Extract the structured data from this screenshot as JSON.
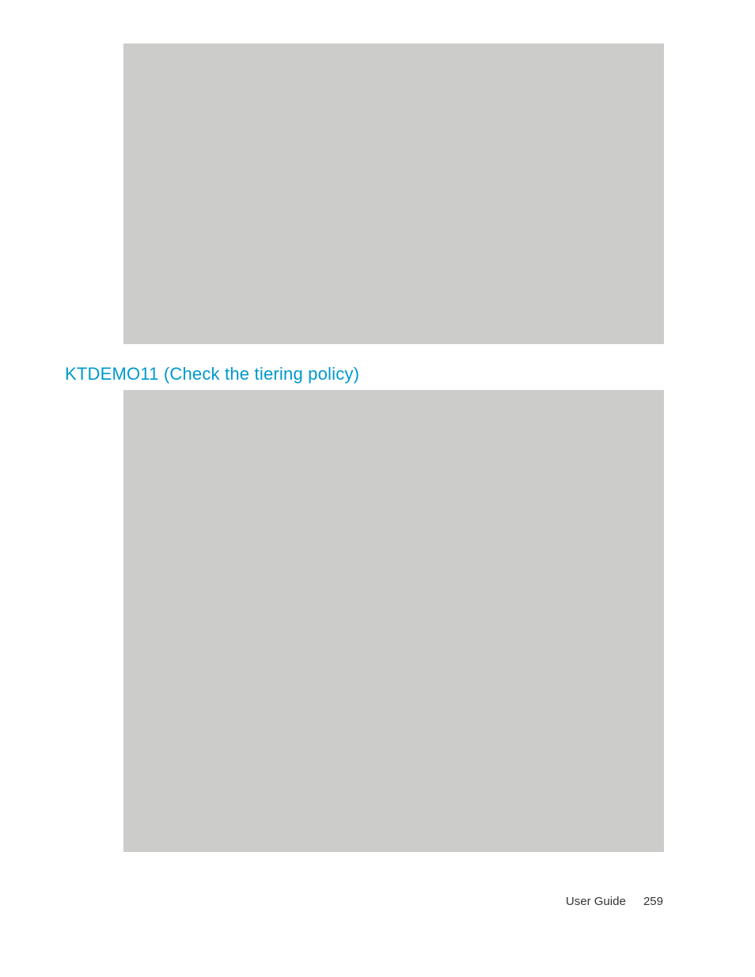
{
  "heading": "KTDEMO11 (Check the tiering policy)",
  "footer": {
    "label": "User Guide",
    "page": "259"
  }
}
